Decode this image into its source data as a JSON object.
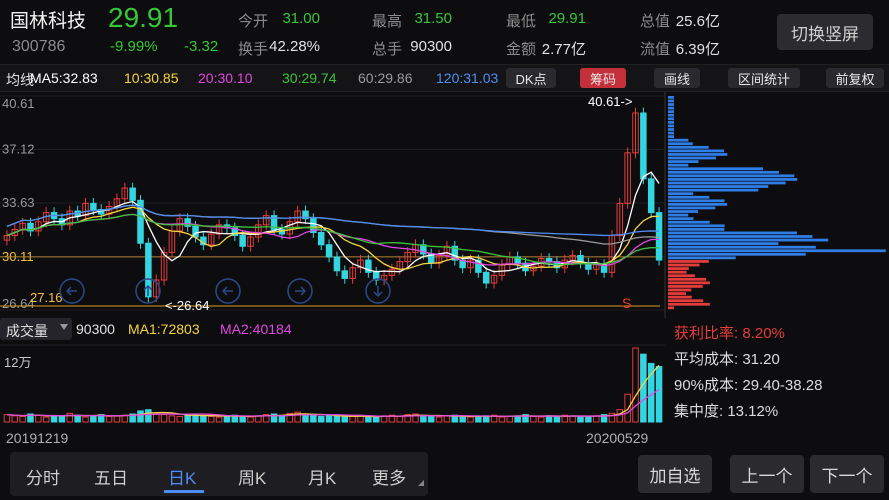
{
  "header": {
    "stock_name": "国林科技",
    "stock_code": "300786",
    "price": "29.91",
    "change_pct": "-9.99%",
    "change_abs": "-3.32",
    "stats": [
      {
        "label": "今开",
        "value": "31.00",
        "tone": "down"
      },
      {
        "label": "最高",
        "value": "31.50",
        "tone": "down"
      },
      {
        "label": "最低",
        "value": "29.91",
        "tone": "down"
      },
      {
        "label": "总值",
        "value": "25.6亿",
        "tone": "neutral"
      },
      {
        "label": "换手",
        "value": "42.28%",
        "tone": "neutral"
      },
      {
        "label": "总手",
        "value": "90300",
        "tone": "neutral"
      },
      {
        "label": "金额",
        "value": "2.77亿",
        "tone": "neutral"
      },
      {
        "label": "流值",
        "value": "6.39亿",
        "tone": "neutral"
      }
    ],
    "switch_button": "切换竖屏"
  },
  "ma_bar": {
    "label": "均线",
    "items": [
      {
        "text": "MA5:32.83",
        "color": "#ffffff"
      },
      {
        "text": "10:30.85",
        "color": "#f5d442"
      },
      {
        "text": "20:30.10",
        "color": "#e247e2"
      },
      {
        "text": "30:29.74",
        "color": "#3ec23e"
      },
      {
        "text": "60:29.86",
        "color": "#9b9b9b"
      },
      {
        "text": "120:31.03",
        "color": "#4f8df5"
      },
      {
        "text": "1:",
        "color": "#e43b3b"
      }
    ],
    "buttons": [
      {
        "label": "DK点",
        "active": false
      },
      {
        "label": "筹码",
        "active": true
      },
      {
        "label": "画线",
        "active": false
      },
      {
        "label": "区间统计",
        "active": false
      },
      {
        "label": "前复权",
        "active": false
      }
    ]
  },
  "price_axis": {
    "labels": [
      "40.61",
      "37.12",
      "33.63",
      "30.11",
      "26.64"
    ],
    "last_price_tag": "30.11",
    "max_marker": "40.61->",
    "min_marker": "<-26.64",
    "cost_line_label": "27.16",
    "s_marker": "S"
  },
  "volume": {
    "selector": "成交量",
    "current": "90300",
    "ma1": "MA1:72803",
    "ma2": "MA2:40184",
    "axis_top": "12万",
    "date_start": "20191219",
    "date_end": "20200529"
  },
  "chip_stats": {
    "profit_ratio_label": "获利比率: ",
    "profit_ratio_value": "8.20%",
    "avg_cost": "平均成本: 31.20",
    "cost_90": "90%成本: 29.40-38.28",
    "concentration": "集中度: 13.12%"
  },
  "tabs": [
    "分时",
    "五日",
    "日K",
    "周K",
    "月K",
    "更多"
  ],
  "active_tab": "日K",
  "bottom_buttons": [
    "加自选",
    "上一个",
    "下一个"
  ],
  "colors": {
    "down": "#37c53a",
    "up": "#e43b3b",
    "accent": "#4f8df5",
    "active_button": "#c4303a"
  },
  "chart_data": {
    "type": "candlestick",
    "y_range": [
      26.64,
      40.61
    ],
    "ma_values": {
      "MA5": 32.83,
      "MA10": 30.85,
      "MA20": 30.1,
      "MA30": 29.74,
      "MA60": 29.86,
      "MA120": 31.03
    },
    "closes": [
      31.5,
      31.9,
      32.3,
      31.8,
      32.4,
      33.0,
      32.6,
      32.2,
      33.1,
      32.8,
      33.6,
      33.2,
      32.9,
      33.4,
      33.9,
      34.6,
      33.8,
      31.0,
      27.5,
      28.6,
      30.4,
      31.8,
      32.6,
      32.1,
      31.4,
      30.9,
      31.6,
      32.2,
      32.0,
      31.5,
      30.8,
      31.4,
      32.2,
      32.8,
      31.9,
      31.6,
      32.4,
      33.1,
      32.6,
      31.7,
      30.9,
      30.1,
      29.2,
      28.7,
      29.4,
      29.9,
      29.1,
      28.6,
      28.9,
      29.3,
      29.8,
      30.4,
      30.9,
      30.3,
      29.7,
      30.2,
      30.8,
      29.9,
      29.4,
      29.9,
      29.1,
      28.4,
      28.9,
      29.6,
      30.1,
      29.7,
      29.2,
      29.5,
      30.0,
      29.8,
      29.4,
      29.9,
      30.2,
      29.7,
      29.3,
      29.6,
      29.1,
      31.5,
      33.6,
      36.9,
      39.5,
      35.2,
      33.0,
      29.9
    ],
    "volumes": [
      1.2,
      1.0,
      0.9,
      1.3,
      1.1,
      0.8,
      1.0,
      0.9,
      1.4,
      1.1,
      0.8,
      1.0,
      1.2,
      0.9,
      1.0,
      1.1,
      1.3,
      1.8,
      2.0,
      1.4,
      1.2,
      1.0,
      0.9,
      1.1,
      1.2,
      1.0,
      0.9,
      0.8,
      1.0,
      1.1,
      0.9,
      0.8,
      1.0,
      1.2,
      1.3,
      1.1,
      1.4,
      1.6,
      1.2,
      1.0,
      0.9,
      1.1,
      1.0,
      0.8,
      0.9,
      1.0,
      0.8,
      0.9,
      1.0,
      1.1,
      0.9,
      1.2,
      1.3,
      1.0,
      0.9,
      0.8,
      1.0,
      1.1,
      0.9,
      0.8,
      0.9,
      1.0,
      1.1,
      0.8,
      0.9,
      1.0,
      1.2,
      0.9,
      0.8,
      1.0,
      0.9,
      1.1,
      1.0,
      0.8,
      0.9,
      1.0,
      1.2,
      1.4,
      2.0,
      4.5,
      12.0,
      11.0,
      9.5,
      9.0
    ]
  }
}
